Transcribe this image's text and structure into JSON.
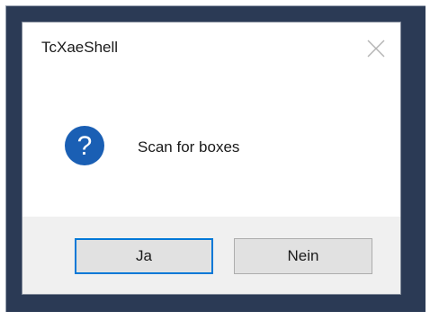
{
  "dialog": {
    "title": "TcXaeShell",
    "message": "Scan for boxes",
    "icon": "question-icon",
    "close_icon": "close-icon"
  },
  "buttons": {
    "yes_label": "Ja",
    "no_label": "Nein"
  },
  "colors": {
    "accent": "#0078d7",
    "icon_blue": "#1a5fb4",
    "footer_bg": "#f0f0f0",
    "desktop_bg": "#2b3a55"
  }
}
